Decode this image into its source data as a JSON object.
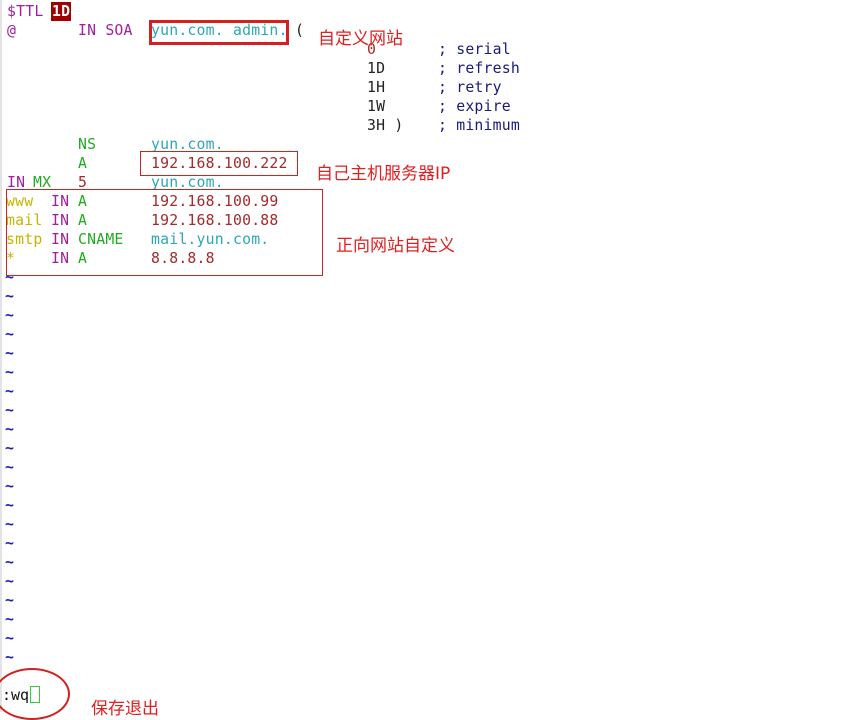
{
  "editor": {
    "mode": "vim",
    "lines": [
      {
        "tokens": [
          {
            "text": "$TTL",
            "role": "directive"
          },
          {
            "text": "1D",
            "role": "highlighted-value"
          }
        ]
      },
      {
        "tokens": [
          {
            "text": "@",
            "role": "origin"
          },
          {
            "text": "IN SOA",
            "role": "class-type"
          },
          {
            "text": "yun.com. admin.",
            "role": "domain"
          },
          {
            "text": "(",
            "role": "paren"
          }
        ]
      },
      {
        "tokens": [
          {
            "text": "0",
            "role": "serial-value"
          },
          {
            "text": "; serial",
            "role": "comment"
          }
        ]
      },
      {
        "tokens": [
          {
            "text": "1D",
            "role": "value"
          },
          {
            "text": "; refresh",
            "role": "comment"
          }
        ]
      },
      {
        "tokens": [
          {
            "text": "1H",
            "role": "value"
          },
          {
            "text": "; retry",
            "role": "comment"
          }
        ]
      },
      {
        "tokens": [
          {
            "text": "1W",
            "role": "value"
          },
          {
            "text": "; expire",
            "role": "comment"
          }
        ]
      },
      {
        "tokens": [
          {
            "text": "3H )",
            "role": "value"
          },
          {
            "text": "; minimum",
            "role": "comment"
          }
        ]
      },
      {
        "tokens": [
          {
            "text": "NS",
            "role": "type"
          },
          {
            "text": "yun.com.",
            "role": "domain"
          }
        ]
      },
      {
        "tokens": [
          {
            "text": "A",
            "role": "type"
          },
          {
            "text": "192.168.100.222",
            "role": "ip"
          }
        ]
      },
      {
        "tokens": [
          {
            "text": "IN",
            "role": "class"
          },
          {
            "text": "MX",
            "role": "type"
          },
          {
            "text": "5",
            "role": "priority"
          },
          {
            "text": "yun.com.",
            "role": "domain"
          }
        ]
      },
      {
        "tokens": [
          {
            "text": "www",
            "role": "host"
          },
          {
            "text": "IN",
            "role": "class"
          },
          {
            "text": "A",
            "role": "type"
          },
          {
            "text": "192.168.100.99",
            "role": "ip"
          }
        ]
      },
      {
        "tokens": [
          {
            "text": "mail",
            "role": "host"
          },
          {
            "text": "IN",
            "role": "class"
          },
          {
            "text": "A",
            "role": "type"
          },
          {
            "text": "192.168.100.88",
            "role": "ip"
          }
        ]
      },
      {
        "tokens": [
          {
            "text": "smtp",
            "role": "host"
          },
          {
            "text": "IN",
            "role": "class"
          },
          {
            "text": "CNAME",
            "role": "type"
          },
          {
            "text": "mail.yun.com.",
            "role": "domain"
          }
        ]
      },
      {
        "tokens": [
          {
            "text": "*",
            "role": "host"
          },
          {
            "text": "IN",
            "role": "class"
          },
          {
            "text": "A",
            "role": "type"
          },
          {
            "text": "8.8.8.8",
            "role": "ip"
          }
        ]
      }
    ],
    "empty_line_marker": "~",
    "empty_line_count": 21,
    "command_line": ":wq"
  },
  "annotations": {
    "custom_site": "自定义网站",
    "host_server_ip": "自己主机服务器IP",
    "forward_site_custom": "正向网站自定义",
    "save_quit": "保存退出"
  },
  "colors": {
    "annotation_red": "#e02020",
    "directive_purple": "#a020a0",
    "type_green": "#22aa22",
    "domain_cyan": "#2aa8b8",
    "ip_red": "#a52a2a",
    "comment_navy": "#1a1a7a",
    "host_yellow": "#c8b400",
    "tilde_blue": "#1c1cb8"
  }
}
